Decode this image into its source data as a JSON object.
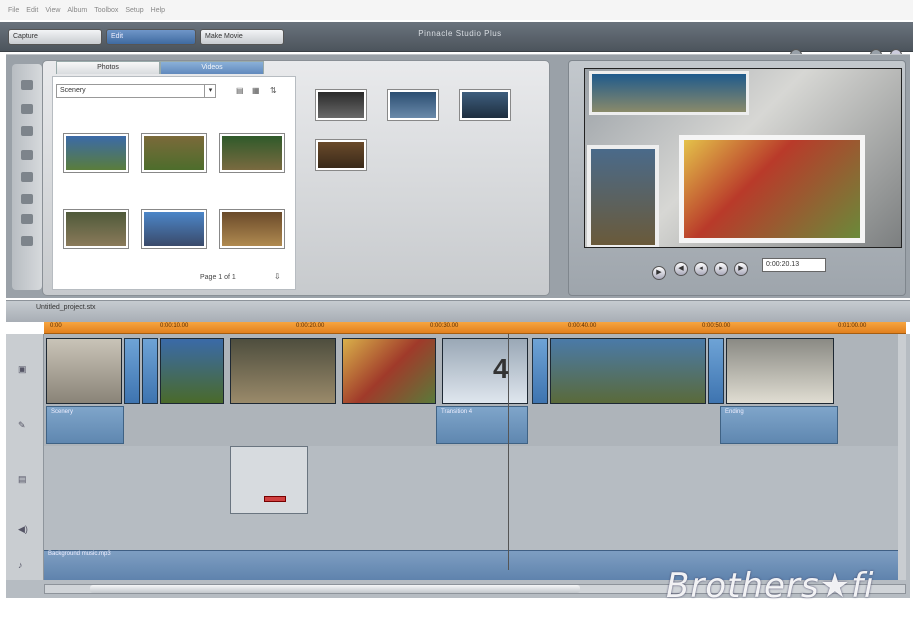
{
  "menu": [
    "File",
    "Edit",
    "View",
    "Album",
    "Toolbox",
    "Setup",
    "Help"
  ],
  "tabs": {
    "capture": "Capture",
    "edit": "Edit",
    "make_movie": "Make Movie"
  },
  "project_title": "Pinnacle Studio Plus",
  "library": {
    "tabs": [
      "Photos",
      "Videos"
    ],
    "album_select": "Scenery",
    "page_label": "Page 1 of 1",
    "thumb_icons": [
      "landscape",
      "landscape",
      "landscape",
      "landscape",
      "landscape",
      "landscape"
    ]
  },
  "toolbox_icons": [
    "scissors-icon",
    "camera-icon",
    "title-icon",
    "transition-icon",
    "photo-icon",
    "music-icon",
    "sound-icon",
    "effect-icon"
  ],
  "preview": {
    "timecode": "0:00:20.13"
  },
  "timeline": {
    "project_name": "Untitled_project.stx",
    "ruler_ticks": [
      "0:00",
      "0:00:10.00",
      "0:00:20.00",
      "0:00:30.00",
      "0:00:40.00",
      "0:00:50.00",
      "0:01:00.00"
    ],
    "clip_labels": [
      "Scenery",
      "Transition 4",
      "Ending"
    ],
    "audio_label": "Background music.mp3"
  },
  "watermark": "Brothers★fi",
  "colors": {
    "accent": "#e2801d",
    "clip_blue": "#5f87b0",
    "transition": "#3e74b0"
  }
}
